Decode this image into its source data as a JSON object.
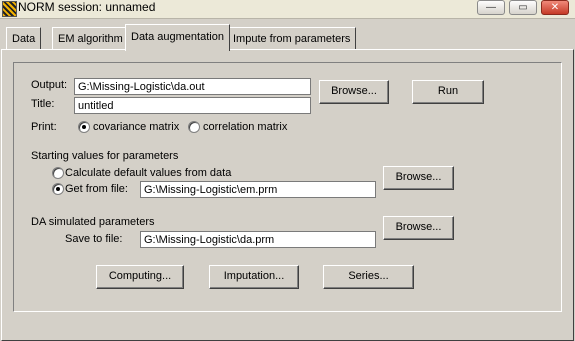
{
  "window": {
    "title": "NORM session: unnamed",
    "controls": {
      "minimize": "—",
      "maximize": "▭",
      "close": "✕"
    }
  },
  "tabs": [
    {
      "label": "Data",
      "active": false
    },
    {
      "label": "EM algorithm",
      "active": false
    },
    {
      "label": "Data augmentation",
      "active": true
    },
    {
      "label": "Impute from parameters",
      "active": false
    }
  ],
  "form": {
    "output_label": "Output:",
    "output_value": "G:\\Missing-Logistic\\da.out",
    "title_label": "Title:",
    "title_value": "untitled",
    "print_label": "Print:",
    "print_options": [
      {
        "label": "covariance matrix",
        "selected": true
      },
      {
        "label": "correlation matrix",
        "selected": false
      }
    ],
    "browse_label": "Browse...",
    "run_label": "Run",
    "starting_heading": "Starting values for parameters",
    "starting_options": [
      {
        "label": "Calculate default values from data",
        "selected": false
      },
      {
        "label": "Get from file:",
        "selected": true
      }
    ],
    "starting_file_value": "G:\\Missing-Logistic\\em.prm",
    "da_heading": "DA simulated parameters",
    "save_label": "Save to file:",
    "save_value": "G:\\Missing-Logistic\\da.prm",
    "computing_label": "Computing...",
    "imputation_label": "Imputation...",
    "series_label": "Series..."
  }
}
